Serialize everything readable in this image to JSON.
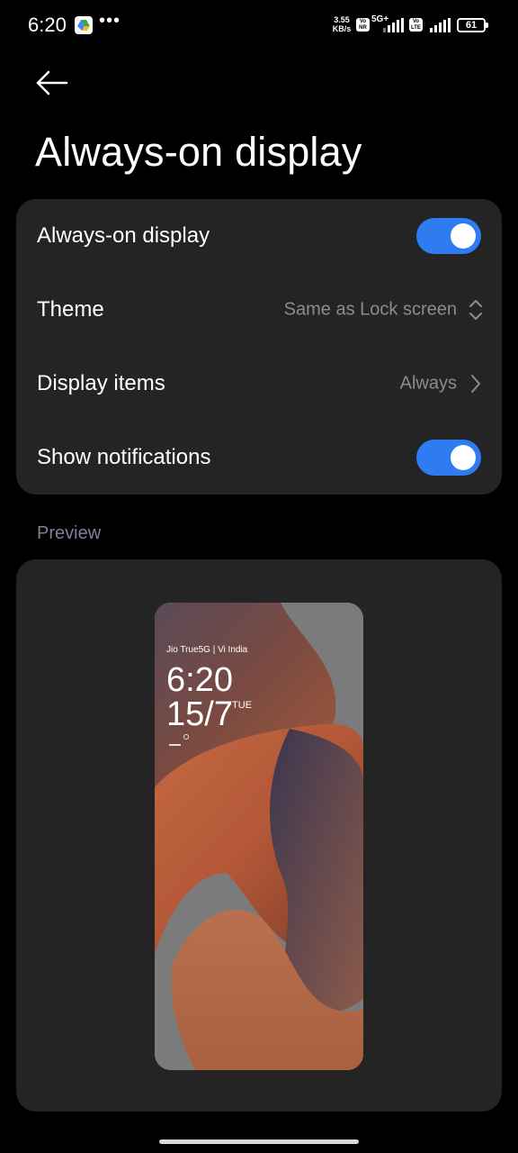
{
  "status_bar": {
    "time": "6:20",
    "more": "•••",
    "net_speed_value": "3.55",
    "net_speed_unit": "KB/s",
    "chip1": "Vo NR",
    "network": "5G+",
    "chip2": "Vo LTE",
    "battery": "61"
  },
  "header": {
    "title": "Always-on display"
  },
  "settings": {
    "aod_label": "Always-on display",
    "aod_enabled": true,
    "theme_label": "Theme",
    "theme_value": "Same as Lock screen",
    "display_items_label": "Display items",
    "display_items_value": "Always",
    "notifications_label": "Show notifications",
    "notifications_enabled": true
  },
  "preview": {
    "section_label": "Preview",
    "carrier": "Jio True5G | Vi India",
    "time": "6:20",
    "date": "15/7",
    "day": "TUE"
  },
  "colors": {
    "accent": "#2f7cf2",
    "background": "#000000",
    "card": "#242424",
    "secondary_text": "#8c8c8c"
  }
}
